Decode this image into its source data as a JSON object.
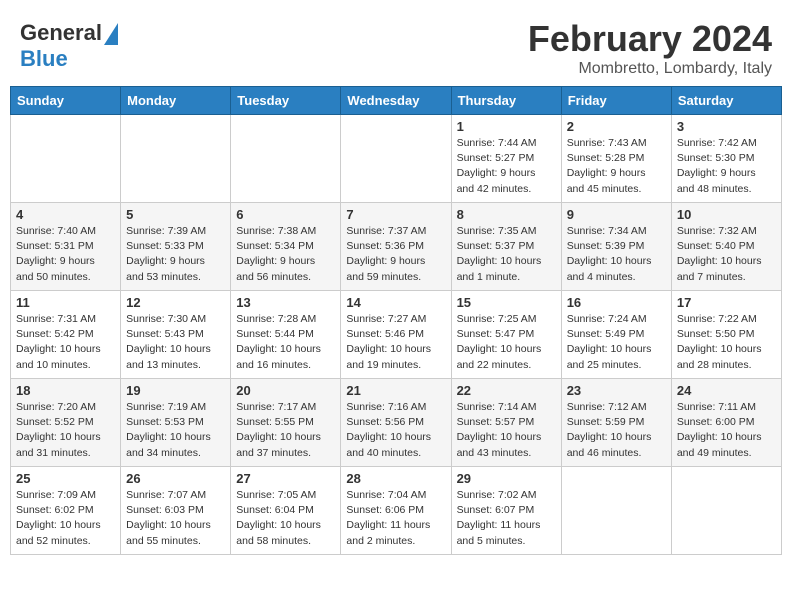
{
  "header": {
    "logo_general": "General",
    "logo_blue": "Blue",
    "month": "February 2024",
    "location": "Mombretto, Lombardy, Italy"
  },
  "days_of_week": [
    "Sunday",
    "Monday",
    "Tuesday",
    "Wednesday",
    "Thursday",
    "Friday",
    "Saturday"
  ],
  "weeks": [
    [
      {
        "day": "",
        "info": ""
      },
      {
        "day": "",
        "info": ""
      },
      {
        "day": "",
        "info": ""
      },
      {
        "day": "",
        "info": ""
      },
      {
        "day": "1",
        "info": "Sunrise: 7:44 AM\nSunset: 5:27 PM\nDaylight: 9 hours\nand 42 minutes."
      },
      {
        "day": "2",
        "info": "Sunrise: 7:43 AM\nSunset: 5:28 PM\nDaylight: 9 hours\nand 45 minutes."
      },
      {
        "day": "3",
        "info": "Sunrise: 7:42 AM\nSunset: 5:30 PM\nDaylight: 9 hours\nand 48 minutes."
      }
    ],
    [
      {
        "day": "4",
        "info": "Sunrise: 7:40 AM\nSunset: 5:31 PM\nDaylight: 9 hours\nand 50 minutes."
      },
      {
        "day": "5",
        "info": "Sunrise: 7:39 AM\nSunset: 5:33 PM\nDaylight: 9 hours\nand 53 minutes."
      },
      {
        "day": "6",
        "info": "Sunrise: 7:38 AM\nSunset: 5:34 PM\nDaylight: 9 hours\nand 56 minutes."
      },
      {
        "day": "7",
        "info": "Sunrise: 7:37 AM\nSunset: 5:36 PM\nDaylight: 9 hours\nand 59 minutes."
      },
      {
        "day": "8",
        "info": "Sunrise: 7:35 AM\nSunset: 5:37 PM\nDaylight: 10 hours\nand 1 minute."
      },
      {
        "day": "9",
        "info": "Sunrise: 7:34 AM\nSunset: 5:39 PM\nDaylight: 10 hours\nand 4 minutes."
      },
      {
        "day": "10",
        "info": "Sunrise: 7:32 AM\nSunset: 5:40 PM\nDaylight: 10 hours\nand 7 minutes."
      }
    ],
    [
      {
        "day": "11",
        "info": "Sunrise: 7:31 AM\nSunset: 5:42 PM\nDaylight: 10 hours\nand 10 minutes."
      },
      {
        "day": "12",
        "info": "Sunrise: 7:30 AM\nSunset: 5:43 PM\nDaylight: 10 hours\nand 13 minutes."
      },
      {
        "day": "13",
        "info": "Sunrise: 7:28 AM\nSunset: 5:44 PM\nDaylight: 10 hours\nand 16 minutes."
      },
      {
        "day": "14",
        "info": "Sunrise: 7:27 AM\nSunset: 5:46 PM\nDaylight: 10 hours\nand 19 minutes."
      },
      {
        "day": "15",
        "info": "Sunrise: 7:25 AM\nSunset: 5:47 PM\nDaylight: 10 hours\nand 22 minutes."
      },
      {
        "day": "16",
        "info": "Sunrise: 7:24 AM\nSunset: 5:49 PM\nDaylight: 10 hours\nand 25 minutes."
      },
      {
        "day": "17",
        "info": "Sunrise: 7:22 AM\nSunset: 5:50 PM\nDaylight: 10 hours\nand 28 minutes."
      }
    ],
    [
      {
        "day": "18",
        "info": "Sunrise: 7:20 AM\nSunset: 5:52 PM\nDaylight: 10 hours\nand 31 minutes."
      },
      {
        "day": "19",
        "info": "Sunrise: 7:19 AM\nSunset: 5:53 PM\nDaylight: 10 hours\nand 34 minutes."
      },
      {
        "day": "20",
        "info": "Sunrise: 7:17 AM\nSunset: 5:55 PM\nDaylight: 10 hours\nand 37 minutes."
      },
      {
        "day": "21",
        "info": "Sunrise: 7:16 AM\nSunset: 5:56 PM\nDaylight: 10 hours\nand 40 minutes."
      },
      {
        "day": "22",
        "info": "Sunrise: 7:14 AM\nSunset: 5:57 PM\nDaylight: 10 hours\nand 43 minutes."
      },
      {
        "day": "23",
        "info": "Sunrise: 7:12 AM\nSunset: 5:59 PM\nDaylight: 10 hours\nand 46 minutes."
      },
      {
        "day": "24",
        "info": "Sunrise: 7:11 AM\nSunset: 6:00 PM\nDaylight: 10 hours\nand 49 minutes."
      }
    ],
    [
      {
        "day": "25",
        "info": "Sunrise: 7:09 AM\nSunset: 6:02 PM\nDaylight: 10 hours\nand 52 minutes."
      },
      {
        "day": "26",
        "info": "Sunrise: 7:07 AM\nSunset: 6:03 PM\nDaylight: 10 hours\nand 55 minutes."
      },
      {
        "day": "27",
        "info": "Sunrise: 7:05 AM\nSunset: 6:04 PM\nDaylight: 10 hours\nand 58 minutes."
      },
      {
        "day": "28",
        "info": "Sunrise: 7:04 AM\nSunset: 6:06 PM\nDaylight: 11 hours\nand 2 minutes."
      },
      {
        "day": "29",
        "info": "Sunrise: 7:02 AM\nSunset: 6:07 PM\nDaylight: 11 hours\nand 5 minutes."
      },
      {
        "day": "",
        "info": ""
      },
      {
        "day": "",
        "info": ""
      }
    ]
  ]
}
